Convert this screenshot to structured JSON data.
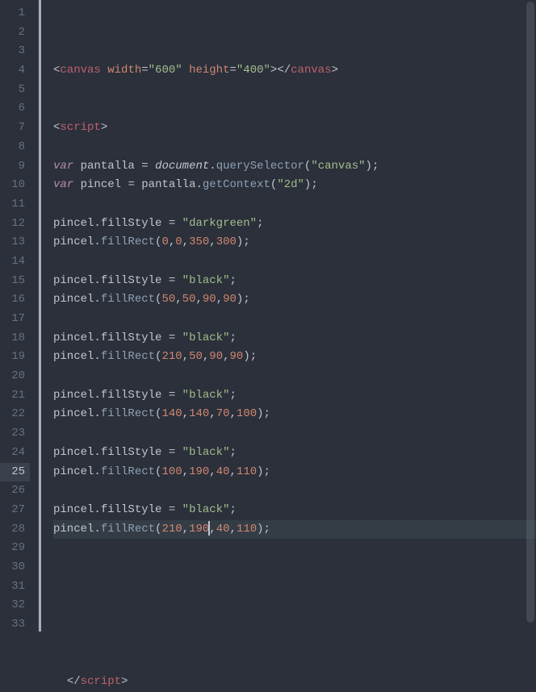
{
  "editor": {
    "active_line": 25,
    "cursor_col_after": "190",
    "lines": [
      {
        "n": 1,
        "html": "<span class='angle'>&lt;</span><span class='tag'>canvas</span> <span class='attr'>width</span><span class='punc'>=</span><span class='str'>\"600\"</span> <span class='attr'>height</span><span class='punc'>=</span><span class='str'>\"400\"</span><span class='angle'>&gt;&lt;/</span><span class='tag'>canvas</span><span class='angle'>&gt;</span>"
      },
      {
        "n": 2,
        "html": ""
      },
      {
        "n": 3,
        "html": ""
      },
      {
        "n": 4,
        "html": "<span class='angle'>&lt;</span><span class='tag'>script</span><span class='angle'>&gt;</span>"
      },
      {
        "n": 5,
        "html": ""
      },
      {
        "n": 6,
        "html": "<span class='kw2'>var</span> <span class='var'>pantalla</span> <span class='punc'>=</span> <span class='obj italic'>document</span><span class='dot'>.</span><span class='fn'>querySelector</span><span class='bracket'>(</span><span class='str'>\"canvas\"</span><span class='bracket'>)</span><span class='punc'>;</span>"
      },
      {
        "n": 7,
        "html": "<span class='kw2'>var</span> <span class='var'>pincel</span> <span class='punc'>=</span> <span class='obj'>pantalla</span><span class='dot'>.</span><span class='fn'>getContext</span><span class='bracket'>(</span><span class='str'>\"2d\"</span><span class='bracket'>)</span><span class='punc'>;</span>"
      },
      {
        "n": 8,
        "html": ""
      },
      {
        "n": 9,
        "html": "<span class='obj'>pincel</span><span class='dot'>.</span><span class='var'>fillStyle</span> <span class='punc'>=</span> <span class='str'>\"darkgreen\"</span><span class='punc'>;</span>"
      },
      {
        "n": 10,
        "html": "<span class='obj'>pincel</span><span class='dot'>.</span><span class='fn'>fillRect</span><span class='bracket'>(</span><span class='num'>0</span><span class='punc'>,</span><span class='num'>0</span><span class='punc'>,</span><span class='num'>350</span><span class='punc'>,</span><span class='num'>300</span><span class='bracket'>)</span><span class='punc'>;</span>"
      },
      {
        "n": 11,
        "html": ""
      },
      {
        "n": 12,
        "html": "<span class='obj'>pincel</span><span class='dot'>.</span><span class='var'>fillStyle</span> <span class='punc'>=</span> <span class='str'>\"black\"</span><span class='punc'>;</span>"
      },
      {
        "n": 13,
        "html": "<span class='obj'>pincel</span><span class='dot'>.</span><span class='fn'>fillRect</span><span class='bracket'>(</span><span class='num'>50</span><span class='punc'>,</span><span class='num'>50</span><span class='punc'>,</span><span class='num'>90</span><span class='punc'>,</span><span class='num'>90</span><span class='bracket'>)</span><span class='punc'>;</span>"
      },
      {
        "n": 14,
        "html": ""
      },
      {
        "n": 15,
        "html": "<span class='obj'>pincel</span><span class='dot'>.</span><span class='var'>fillStyle</span> <span class='punc'>=</span> <span class='str'>\"black\"</span><span class='punc'>;</span>"
      },
      {
        "n": 16,
        "html": "<span class='obj'>pincel</span><span class='dot'>.</span><span class='fn'>fillRect</span><span class='bracket'>(</span><span class='num'>210</span><span class='punc'>,</span><span class='num'>50</span><span class='punc'>,</span><span class='num'>90</span><span class='punc'>,</span><span class='num'>90</span><span class='bracket'>)</span><span class='punc'>;</span>"
      },
      {
        "n": 17,
        "html": ""
      },
      {
        "n": 18,
        "html": "<span class='obj'>pincel</span><span class='dot'>.</span><span class='var'>fillStyle</span> <span class='punc'>=</span> <span class='str'>\"black\"</span><span class='punc'>;</span>"
      },
      {
        "n": 19,
        "html": "<span class='obj'>pincel</span><span class='dot'>.</span><span class='fn'>fillRect</span><span class='bracket'>(</span><span class='num'>140</span><span class='punc'>,</span><span class='num'>140</span><span class='punc'>,</span><span class='num'>70</span><span class='punc'>,</span><span class='num'>100</span><span class='bracket'>)</span><span class='punc'>;</span>"
      },
      {
        "n": 20,
        "html": ""
      },
      {
        "n": 21,
        "html": "<span class='obj'>pincel</span><span class='dot'>.</span><span class='var'>fillStyle</span> <span class='punc'>=</span> <span class='str'>\"black\"</span><span class='punc'>;</span>"
      },
      {
        "n": 22,
        "html": "<span class='obj'>pincel</span><span class='dot'>.</span><span class='fn'>fillRect</span><span class='bracket'>(</span><span class='num'>100</span><span class='punc'>,</span><span class='num'>190</span><span class='punc'>,</span><span class='num'>40</span><span class='punc'>,</span><span class='num'>110</span><span class='bracket'>)</span><span class='punc'>;</span>"
      },
      {
        "n": 23,
        "html": ""
      },
      {
        "n": 24,
        "html": "<span class='obj'>pincel</span><span class='dot'>.</span><span class='var'>fillStyle</span> <span class='punc'>=</span> <span class='str'>\"black\"</span><span class='punc'>;</span>"
      },
      {
        "n": 25,
        "html": "<span class='obj'>pincel</span><span class='dot'>.</span><span class='fn'>fillRect</span><span class='bracket'>(</span><span class='num'>210</span><span class='punc'>,</span><span class='num'>190</span><span class='cursor'></span><span class='punc'>,</span><span class='num'>40</span><span class='punc'>,</span><span class='num'>110</span><span class='bracket'>)</span><span class='punc'>;</span>",
        "active": true
      },
      {
        "n": 26,
        "html": ""
      },
      {
        "n": 27,
        "html": ""
      },
      {
        "n": 28,
        "html": ""
      },
      {
        "n": 29,
        "html": ""
      },
      {
        "n": 30,
        "html": ""
      },
      {
        "n": 31,
        "html": ""
      },
      {
        "n": 32,
        "html": ""
      },
      {
        "n": 33,
        "html": "  <span class='angle'>&lt;/</span><span class='tag'>script</span><span class='angle'>&gt;</span>"
      }
    ]
  }
}
